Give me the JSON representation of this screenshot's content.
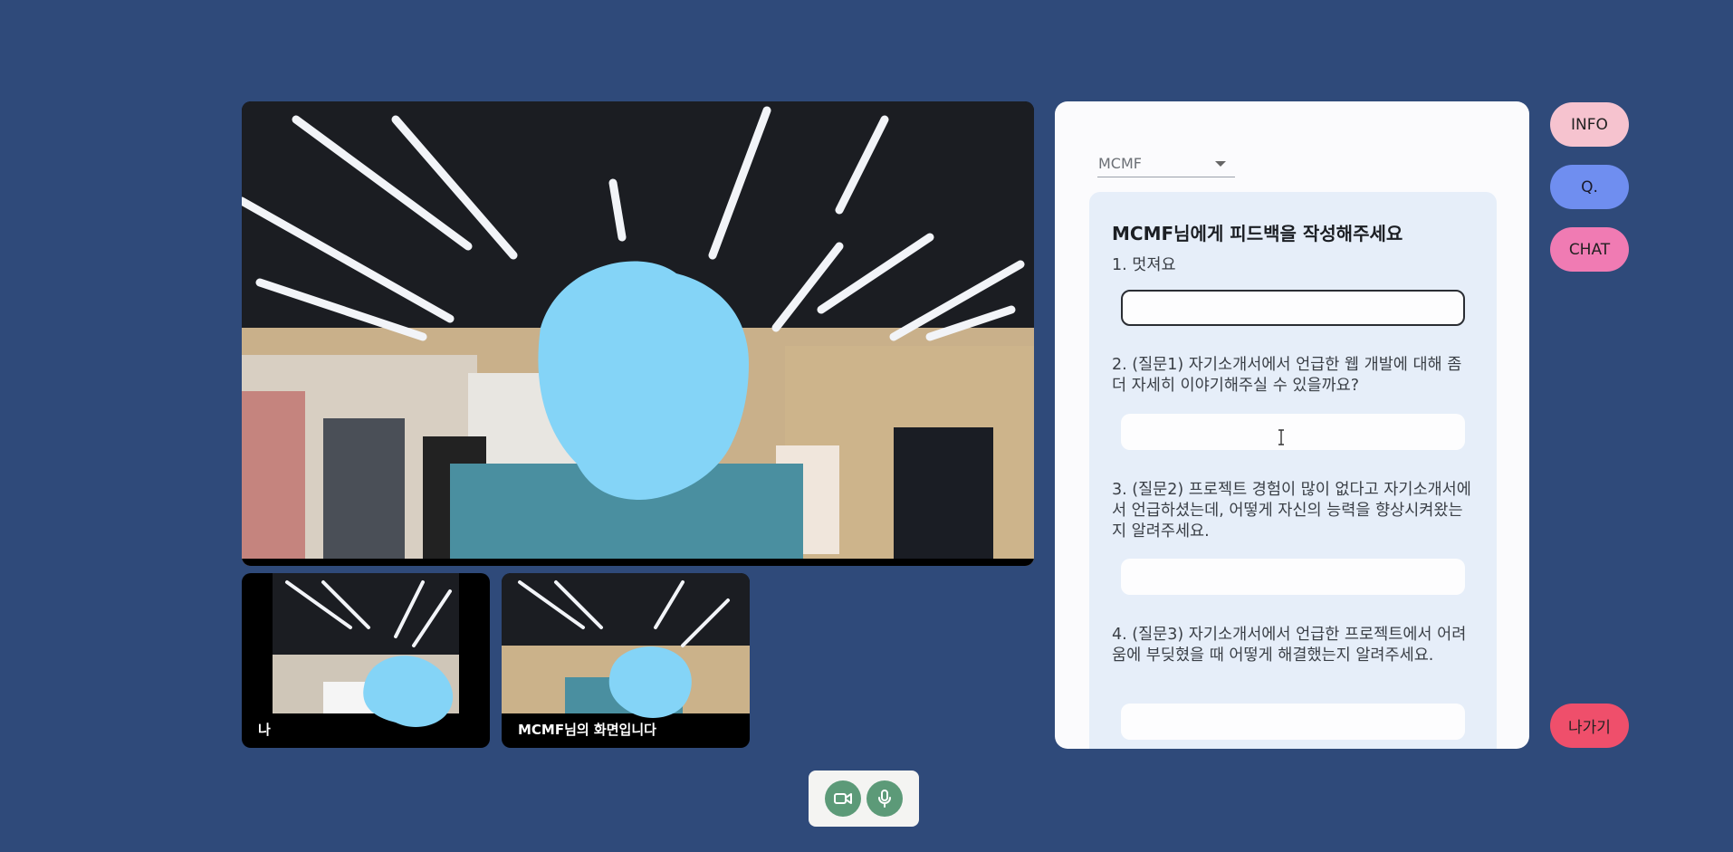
{
  "main_video": {
    "label": ""
  },
  "thumbnails": [
    {
      "label": "나"
    },
    {
      "label": "MCMF님의 화면입니다"
    }
  ],
  "feedback_panel": {
    "selected_user": "MCMF",
    "title": "MCMF님에게 피드백을 작성해주세요",
    "questions": [
      {
        "text": "1. 멋져요",
        "value": ""
      },
      {
        "text": "2. (질문1) 자기소개서에서 언급한 웹 개발에 대해 좀 더 자세히 이야기해주실 수 있을까요?",
        "value": ""
      },
      {
        "text": "3. (질문2) 프로젝트 경험이 많이 없다고 자기소개서에서 언급하셨는데, 어떻게 자신의 능력을 향상시켜왔는지 알려주세요.",
        "value": ""
      },
      {
        "text": "4. (질문3) 자기소개서에서 언급한 프로젝트에서 어려움에 부딪혔을 때 어떻게 해결했는지 알려주세요.",
        "value": ""
      }
    ]
  },
  "side_buttons": {
    "info": "INFO",
    "q": "Q.",
    "chat": "CHAT",
    "exit": "나가기"
  },
  "icons": {
    "camera": "video-camera-icon",
    "mic": "microphone-icon"
  },
  "colors": {
    "background": "#2f4a7a",
    "info": "#f6c3cf",
    "q": "#6f8ef0",
    "chat": "#f07bb3",
    "exit": "#ef4f6b",
    "control_icon": "#5c9a78"
  }
}
